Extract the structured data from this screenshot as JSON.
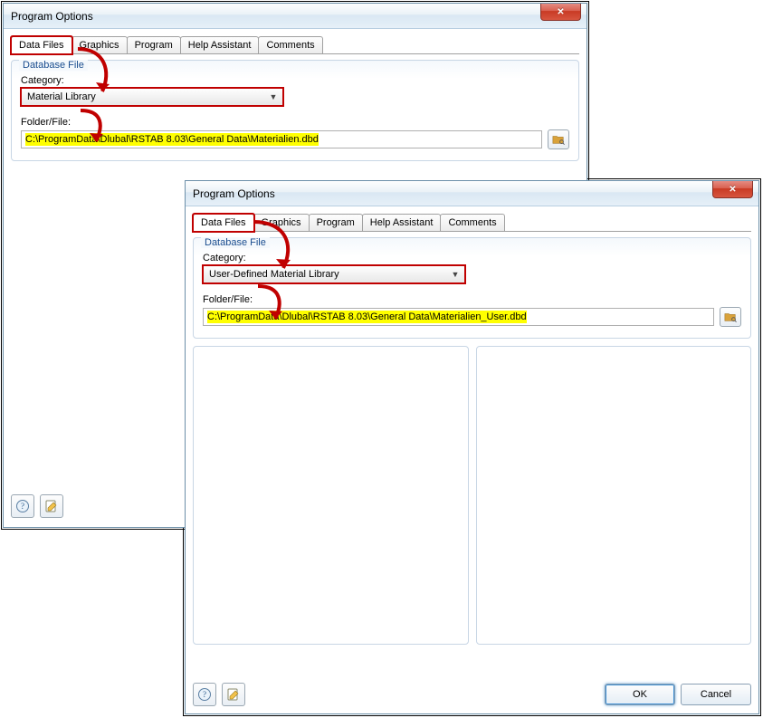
{
  "window1": {
    "title": "Program Options",
    "tabs": [
      "Data Files",
      "Graphics",
      "Program",
      "Help Assistant",
      "Comments"
    ],
    "activeTab": 0,
    "fieldset": {
      "legend": "Database File",
      "categoryLabel": "Category:",
      "categoryValue": "Material Library",
      "folderLabel": "Folder/File:",
      "folderValue": "C:\\ProgramData\\Dlubal\\RSTAB 8.03\\General Data\\Materialien.dbd"
    }
  },
  "window2": {
    "title": "Program Options",
    "tabs": [
      "Data Files",
      "Graphics",
      "Program",
      "Help Assistant",
      "Comments"
    ],
    "activeTab": 0,
    "fieldset": {
      "legend": "Database File",
      "categoryLabel": "Category:",
      "categoryValue": "User-Defined Material Library",
      "folderLabel": "Folder/File:",
      "folderValue": "C:\\ProgramData\\Dlubal\\RSTAB 8.03\\General Data\\Materialien_User.dbd"
    },
    "buttons": {
      "ok": "OK",
      "cancel": "Cancel"
    }
  }
}
